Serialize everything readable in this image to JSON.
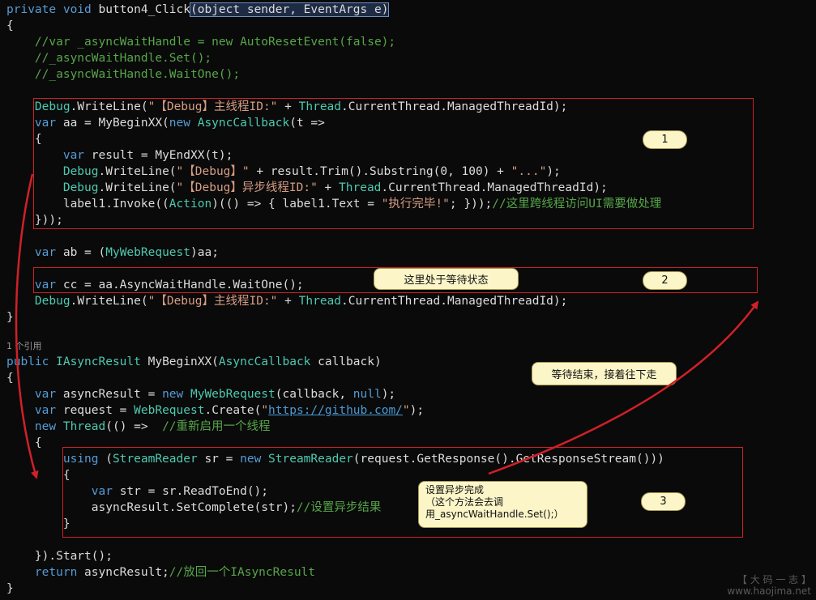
{
  "code": {
    "lines": [
      [
        {
          "c": "kw",
          "t": "private "
        },
        {
          "c": "kw",
          "t": "void "
        },
        {
          "c": "id",
          "t": "button4_Click"
        },
        {
          "c": "sel",
          "t": "(object sender, EventArgs e)"
        }
      ],
      [
        {
          "c": "id",
          "t": "{"
        }
      ],
      [
        {
          "c": "cm",
          "t": "    //var _asyncWaitHandle = new AutoResetEvent(false);"
        }
      ],
      [
        {
          "c": "cm",
          "t": "    //_asyncWaitHandle.Set();"
        }
      ],
      [
        {
          "c": "cm",
          "t": "    //_asyncWaitHandle.WaitOne();"
        }
      ],
      [],
      [
        {
          "c": "ty",
          "t": "    Debug"
        },
        {
          "c": "id",
          "t": ".WriteLine("
        },
        {
          "c": "st",
          "t": "\"【Debug】主线程ID:\""
        },
        {
          "c": "id",
          "t": " + "
        },
        {
          "c": "ty",
          "t": "Thread"
        },
        {
          "c": "id",
          "t": ".CurrentThread.ManagedThreadId);"
        }
      ],
      [
        {
          "c": "kw",
          "t": "    var "
        },
        {
          "c": "id",
          "t": "aa = MyBeginXX("
        },
        {
          "c": "kw",
          "t": "new "
        },
        {
          "c": "ty",
          "t": "AsyncCallback"
        },
        {
          "c": "id",
          "t": "(t =>"
        }
      ],
      [
        {
          "c": "id",
          "t": "    {"
        }
      ],
      [
        {
          "c": "kw",
          "t": "        var "
        },
        {
          "c": "id",
          "t": "result = MyEndXX(t);"
        }
      ],
      [
        {
          "c": "ty",
          "t": "        Debug"
        },
        {
          "c": "id",
          "t": ".WriteLine("
        },
        {
          "c": "st",
          "t": "\"【Debug】\""
        },
        {
          "c": "id",
          "t": " + result.Trim().Substring(0, 100) + "
        },
        {
          "c": "st",
          "t": "\"...\""
        },
        {
          "c": "id",
          "t": ");"
        }
      ],
      [
        {
          "c": "ty",
          "t": "        Debug"
        },
        {
          "c": "id",
          "t": ".WriteLine("
        },
        {
          "c": "st",
          "t": "\"【Debug】异步线程ID:\""
        },
        {
          "c": "id",
          "t": " + "
        },
        {
          "c": "ty",
          "t": "Thread"
        },
        {
          "c": "id",
          "t": ".CurrentThread.ManagedThreadId);"
        }
      ],
      [
        {
          "c": "id",
          "t": "        label1.Invoke(("
        },
        {
          "c": "ty",
          "t": "Action"
        },
        {
          "c": "id",
          "t": ")(() => { label1.Text = "
        },
        {
          "c": "st",
          "t": "\"执行完毕!\""
        },
        {
          "c": "id",
          "t": "; }));"
        },
        {
          "c": "cm",
          "t": "//这里跨线程访问UI需要做处理"
        }
      ],
      [
        {
          "c": "id",
          "t": "    }));"
        }
      ],
      [],
      [
        {
          "c": "kw",
          "t": "    var "
        },
        {
          "c": "id",
          "t": "ab = ("
        },
        {
          "c": "ty",
          "t": "MyWebRequest"
        },
        {
          "c": "id",
          "t": ")aa;"
        }
      ],
      [],
      [
        {
          "c": "kw",
          "t": "    var "
        },
        {
          "c": "id",
          "t": "cc = aa.AsyncWaitHandle.WaitOne();"
        }
      ],
      [
        {
          "c": "ty",
          "t": "    Debug"
        },
        {
          "c": "id",
          "t": ".WriteLine("
        },
        {
          "c": "st",
          "t": "\"【Debug】主线程ID:\""
        },
        {
          "c": "id",
          "t": " + "
        },
        {
          "c": "ty",
          "t": "Thread"
        },
        {
          "c": "id",
          "t": ".CurrentThread.ManagedThreadId);"
        }
      ],
      [
        {
          "c": "id",
          "t": "}"
        }
      ]
    ],
    "refs_label": "1 个引用",
    "lines2": [
      [
        {
          "c": "kw",
          "t": "public "
        },
        {
          "c": "ty",
          "t": "IAsyncResult "
        },
        {
          "c": "id",
          "t": "MyBeginXX("
        },
        {
          "c": "ty",
          "t": "AsyncCallback "
        },
        {
          "c": "id",
          "t": "callback)"
        }
      ],
      [
        {
          "c": "id",
          "t": "{"
        }
      ],
      [
        {
          "c": "kw",
          "t": "    var "
        },
        {
          "c": "id",
          "t": "asyncResult = "
        },
        {
          "c": "kw",
          "t": "new "
        },
        {
          "c": "ty",
          "t": "MyWebRequest"
        },
        {
          "c": "id",
          "t": "(callback, "
        },
        {
          "c": "kw",
          "t": "null"
        },
        {
          "c": "id",
          "t": ");"
        }
      ],
      [
        {
          "c": "kw",
          "t": "    var "
        },
        {
          "c": "id",
          "t": "request = "
        },
        {
          "c": "ty",
          "t": "WebRequest"
        },
        {
          "c": "id",
          "t": ".Create("
        },
        {
          "c": "st",
          "t": "\""
        },
        {
          "c": "lnk",
          "t": "https://github.com/"
        },
        {
          "c": "st",
          "t": "\""
        },
        {
          "c": "id",
          "t": ");"
        }
      ],
      [
        {
          "c": "kw",
          "t": "    new "
        },
        {
          "c": "ty",
          "t": "Thread"
        },
        {
          "c": "id",
          "t": "(() =>  "
        },
        {
          "c": "cm",
          "t": "//重新启用一个线程"
        }
      ],
      [
        {
          "c": "id",
          "t": "    {"
        }
      ],
      [
        {
          "c": "kw",
          "t": "        using "
        },
        {
          "c": "id",
          "t": "("
        },
        {
          "c": "ty",
          "t": "StreamReader "
        },
        {
          "c": "id",
          "t": "sr = "
        },
        {
          "c": "kw",
          "t": "new "
        },
        {
          "c": "ty",
          "t": "StreamReader"
        },
        {
          "c": "id",
          "t": "(request.GetResponse().GetResponseStream()))"
        }
      ],
      [
        {
          "c": "id",
          "t": "        {"
        }
      ],
      [
        {
          "c": "kw",
          "t": "            var "
        },
        {
          "c": "id",
          "t": "str = sr.ReadToEnd();"
        }
      ],
      [
        {
          "c": "id",
          "t": "            asyncResult.SetComplete(str);"
        },
        {
          "c": "cm",
          "t": "//设置异步结果"
        }
      ],
      [
        {
          "c": "id",
          "t": "        }"
        }
      ],
      [],
      [
        {
          "c": "id",
          "t": "    }).Start();"
        }
      ],
      [
        {
          "c": "kw",
          "t": "    return "
        },
        {
          "c": "id",
          "t": "asyncResult;"
        },
        {
          "c": "cm",
          "t": "//放回一个IAsyncResult"
        }
      ],
      [
        {
          "c": "id",
          "t": "}"
        }
      ]
    ]
  },
  "annotations": {
    "badge1": "1",
    "badge2": "2",
    "badge3": "3",
    "wait_state": "这里处于等待状态",
    "wait_done": "等待结束，接着往下走",
    "set_complete_title": "设置异步完成",
    "set_complete_line2": "（这个方法会去调",
    "set_complete_line3": "用_asyncWaitHandle.Set();）"
  },
  "colors": {
    "background": "#0a0a0a",
    "keyword": "#569cd6",
    "type": "#4ec9b0",
    "comment": "#57a64a",
    "string": "#d69d85",
    "annotation_red": "#d02028",
    "callout_bg": "#fbf5c8"
  },
  "watermark": {
    "line1": "【 大 码 一 志 】",
    "line2": "www.haojima.net"
  }
}
